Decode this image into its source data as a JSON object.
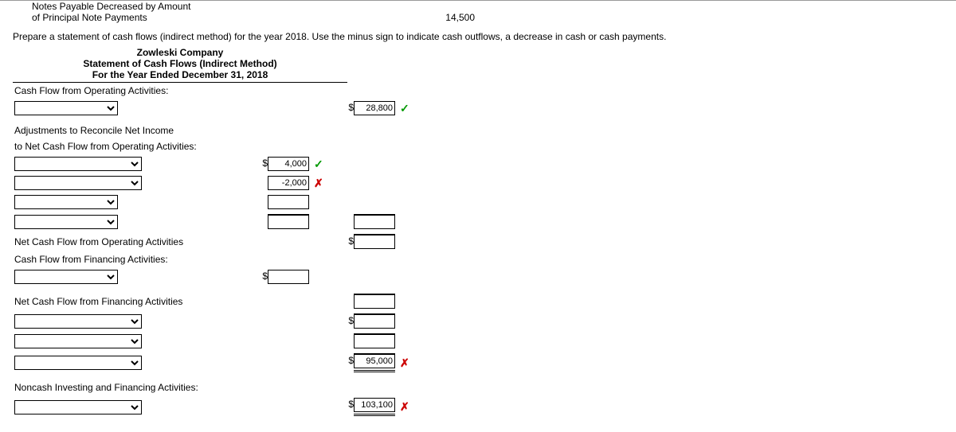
{
  "top": {
    "line1": "Notes Payable Decreased by Amount",
    "line2": "of Principal Note Payments",
    "value": "14,500"
  },
  "instruction": "Prepare a statement of cash flows (indirect method) for the year 2018. Use the minus sign to indicate cash outflows, a decrease in cash or cash payments.",
  "header": {
    "l1": "Zowleski Company",
    "l2": "Statement of Cash Flows (Indirect Method)",
    "l3": "For the Year Ended December 31, 2018"
  },
  "labels": {
    "cfo_title": "Cash Flow from Operating Activities:",
    "adj1": "Adjustments to Reconcile Net Income",
    "adj2": "to Net Cash Flow from Operating Activities:",
    "ncfo": "Net Cash Flow from Operating Activities",
    "cff_title": "Cash Flow from Financing Activities:",
    "ncff": "Net Cash Flow from Financing Activities",
    "noncash": "Noncash Investing and Financing Activities:"
  },
  "values": {
    "net_income": "28,800",
    "adj_a": "4,000",
    "adj_b": "-2,000",
    "total_a": "95,000",
    "total_b": "103,100"
  },
  "marks": {
    "check": "✓",
    "cross": "✗"
  }
}
